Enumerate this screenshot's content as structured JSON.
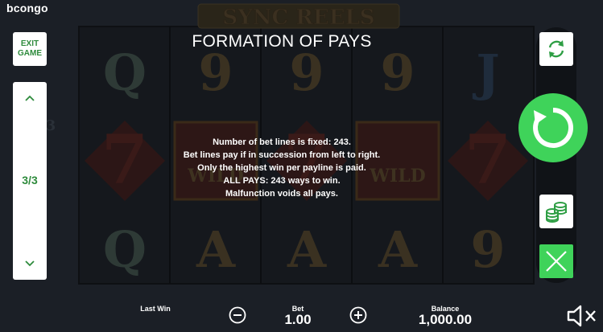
{
  "brand": {
    "logo_text": "bcongo"
  },
  "game": {
    "logo_text": "SYNC REELS",
    "wild_label": "WILD"
  },
  "reels": {
    "row1": [
      "Q",
      "9",
      "9",
      "9",
      "J"
    ],
    "row3": [
      "Q",
      "A",
      "A",
      "A",
      "9"
    ],
    "center_sevens": "7",
    "left_edge_glyph": "3"
  },
  "nav": {
    "exit_line1": "EXIT",
    "exit_line2": "GAME",
    "page_indicator": "3/3"
  },
  "paytable": {
    "title": "FORMATION OF PAYS",
    "lines": [
      "Number of bet lines is fixed: 243.",
      "Bet lines pay if in succession from left to right.",
      "Only the highest win per payline is paid.",
      "ALL PAYS: 243 ways to win.",
      "Malfunction voids all pays."
    ]
  },
  "bottom_bar": {
    "last_win_label": "Last Win",
    "bet_label": "Bet",
    "bet_value": "1.00",
    "balance_label": "Balance",
    "balance_value": "1,000.00"
  },
  "icons": {
    "autoplay": "autoplay-icon",
    "spin": "spin-icon",
    "coins": "coins-icon",
    "close": "close-icon",
    "minus": "minus-icon",
    "plus": "plus-icon",
    "sound": "sound-muted-icon"
  },
  "colors": {
    "accent_green": "#3fd35a",
    "text_green": "#2e8b3c",
    "background": "#1b1f26"
  }
}
